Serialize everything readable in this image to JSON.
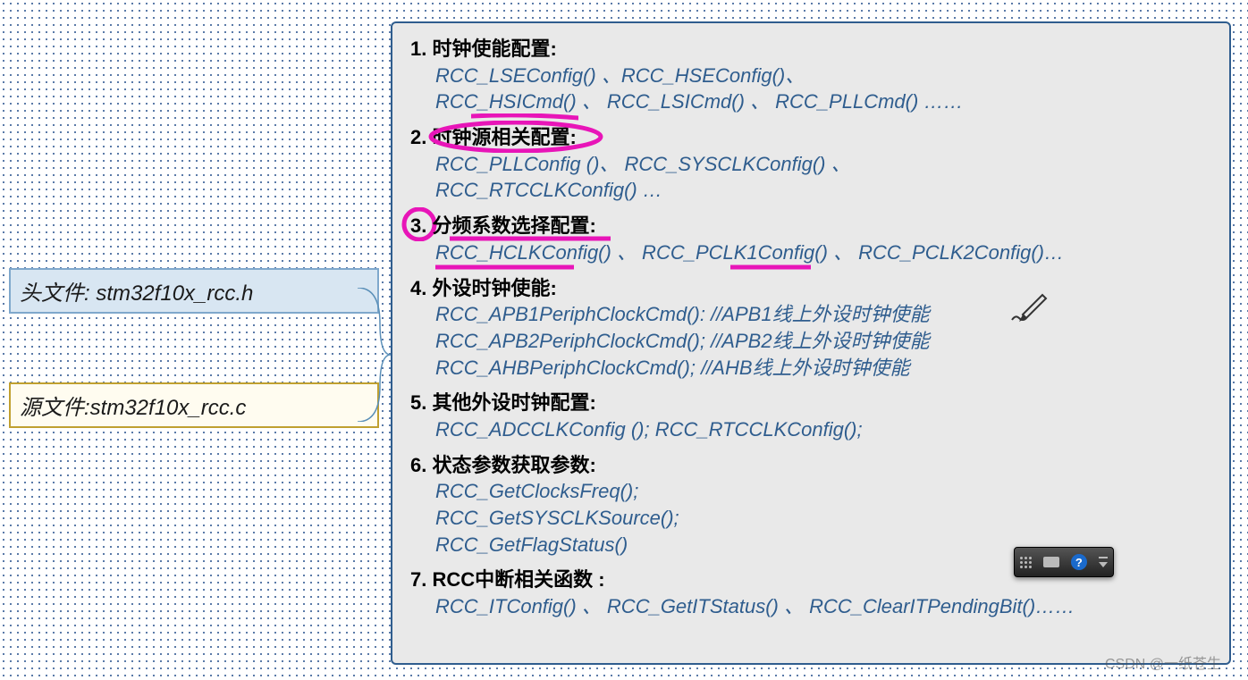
{
  "files": {
    "header_label": "头文件: stm32f10x_rcc.h",
    "source_label": "源文件:stm32f10x_rcc.c"
  },
  "sections": [
    {
      "num": "1.",
      "title": "时钟使能配置:",
      "lines": [
        "RCC_LSEConfig() 、RCC_HSEConfig()、",
        "RCC_HSICmd() 、 RCC_LSICmd() 、 RCC_PLLCmd() ……"
      ]
    },
    {
      "num": "2.",
      "title": "时钟源相关配置:",
      "lines": [
        "RCC_PLLConfig ()、 RCC_SYSCLKConfig() 、",
        "RCC_RTCCLKConfig() …"
      ]
    },
    {
      "num": "3.",
      "title": "分频系数选择配置:",
      "lines": [
        "RCC_HCLKConfig() 、 RCC_PCLK1Config() 、 RCC_PCLK2Config()…"
      ]
    },
    {
      "num": "4.",
      "title": "外设时钟使能:",
      "lines": [
        "RCC_APB1PeriphClockCmd():  //APB1线上外设时钟使能",
        "RCC_APB2PeriphClockCmd();  //APB2线上外设时钟使能",
        "RCC_AHBPeriphClockCmd();   //AHB线上外设时钟使能"
      ]
    },
    {
      "num": "5.",
      "title": "其他外设时钟配置:",
      "lines": [
        "RCC_ADCCLKConfig ();  RCC_RTCCLKConfig();"
      ]
    },
    {
      "num": "6.",
      "title": "状态参数获取参数:",
      "lines": [
        "RCC_GetClocksFreq();",
        "RCC_GetSYSCLKSource();",
        "RCC_GetFlagStatus()"
      ]
    },
    {
      "num": "7.",
      "title": "RCC中断相关函数 :",
      "lines": [
        "RCC_ITConfig() 、 RCC_GetITStatus() 、 RCC_ClearITPendingBit()……"
      ]
    }
  ],
  "watermark": "CSDN @一纸苍生"
}
